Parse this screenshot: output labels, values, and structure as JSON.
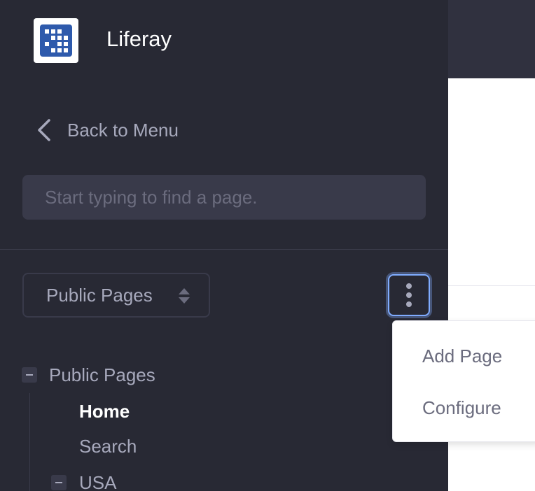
{
  "site": {
    "name": "Liferay",
    "logo_icon": "liferay-logo-icon"
  },
  "navigation": {
    "back_label": "Back to Menu",
    "back_icon": "chevron-left-icon"
  },
  "search": {
    "placeholder": "Start typing to find a page.",
    "value": ""
  },
  "pages_select": {
    "label": "Public Pages",
    "caret_icon": "sort-caret-icon"
  },
  "options_button": {
    "icon": "ellipsis-v-icon"
  },
  "dropdown": {
    "items": [
      {
        "label": "Add Page"
      },
      {
        "label": "Configure"
      }
    ]
  },
  "tree": {
    "root": {
      "label": "Public Pages",
      "expanded": true
    },
    "children": [
      {
        "label": "Home",
        "active": true
      },
      {
        "label": "Search",
        "active": false
      },
      {
        "label": "USA",
        "expanded": true
      }
    ]
  },
  "colors": {
    "sidebar_bg": "#282934",
    "input_bg": "#393a4a",
    "focus_ring": "#80acff",
    "brand_blue": "#2e5aac"
  }
}
